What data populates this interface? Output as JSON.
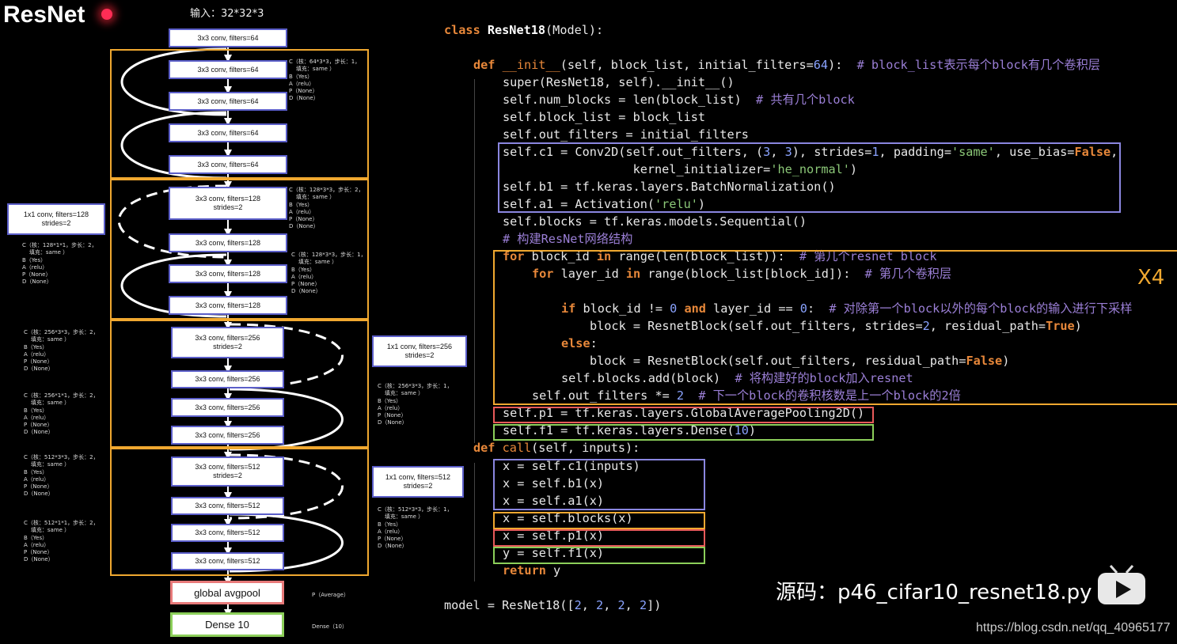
{
  "header": {
    "title": "ResNet",
    "input": "输入：32*32*3"
  },
  "diagram": {
    "stem": "3x3 conv, filters=64",
    "stage1": [
      "3x3 conv, filters=64",
      "3x3 conv, filters=64",
      "3x3 conv, filters=64",
      "3x3 conv, filters=64"
    ],
    "stage2": [
      "3x3 conv, filters=128\nstrides=2",
      "3x3 conv, filters=128",
      "3x3 conv, filters=128",
      "3x3 conv, filters=128"
    ],
    "stage3": [
      "3x3 conv, filters=256\nstrides=2",
      "3x3 conv, filters=256",
      "3x3 conv, filters=256",
      "3x3 conv, filters=256"
    ],
    "stage4": [
      "3x3 conv, filters=512\nstrides=2",
      "3x3 conv, filters=512",
      "3x3 conv, filters=512",
      "3x3 conv, filters=512"
    ],
    "shortcut128": "1x1 conv, filters=128\nstrides=2",
    "shortcut256": "1x1 conv, filters=256\nstrides=2",
    "shortcut512": "1x1 conv, filters=512\nstrides=2",
    "pool": "global avgpool",
    "dense": "Dense 10",
    "notes": {
      "s1": "C（核：64*3*3，步长：1，\n    填充：same ）\nB（Yes）\nA（relu）\nP（None）\nD（None）",
      "s2a": "C（核：128*3*3，步长：2，\n    填充：same ）\nB（Yes）\nA（relu）\nP（None）\nD（None）",
      "s2b": "C（核：128*3*3，步长：1，\n    填充：same ）\nB（Yes）\nA（relu）\nP（None）\nD（None）",
      "sc128": "C（核：128*1*1，步长：2，\n    填充：same ）\nB（Yes）\nA（relu）\nP（None）\nD（None）",
      "s3a": "C（核：256*3*3，步长：2，\n    填充：same ）\nB（Yes）\nA（relu）\nP（None）\nD（None）",
      "s3b": "C（核：256*1*1，步长：2，\n    填充：same ）\nB（Yes）\nA（relu）\nP（None）\nD（None）",
      "sc256": "C（核：256*3*3，步长：1，\n    填充：same ）\nB（Yes）\nA（relu）\nP（None）\nD（None）",
      "s4a": "C（核：512*3*3，步长：2，\n    填充：same ）\nB（Yes）\nA（relu）\nP（None）\nD（None）",
      "s4b": "C（核：512*1*1，步长：2，\n    填充：same ）\nB（Yes）\nA（relu）\nP（None）\nD（None）",
      "sc512": "C（核：512*3*3，步长：1，\n    填充：same ）\nB（Yes）\nA（relu）\nP（None）\nD（None）",
      "pool": "P（Average）",
      "dense": "Dense（10）"
    }
  },
  "code": {
    "lines": [
      [
        [
          "kw",
          "class "
        ],
        [
          "cls",
          "ResNet18"
        ],
        [
          "",
          "(Model):"
        ]
      ],
      [],
      [
        [
          "kw",
          "def "
        ],
        [
          "kw2",
          "__init__"
        ],
        [
          "",
          "(self, block_list, initial_filters="
        ],
        [
          "num",
          "64"
        ],
        [
          "",
          "):  "
        ],
        [
          "cmt",
          "# block_list表示每个block有几个卷积层"
        ]
      ],
      [
        [
          "",
          "super(ResNet18, self).__init__()"
        ]
      ],
      [
        [
          "",
          "self.num_blocks = len(block_list)  "
        ],
        [
          "cmt",
          "# 共有几个block"
        ]
      ],
      [
        [
          "",
          "self.block_list = block_list"
        ]
      ],
      [
        [
          "",
          "self.out_filters = initial_filters"
        ]
      ],
      [
        [
          "",
          "self.c1 = Conv2D(self.out_filters, ("
        ],
        [
          "num",
          "3"
        ],
        [
          "",
          ", "
        ],
        [
          "num",
          "3"
        ],
        [
          "",
          "), strides="
        ],
        [
          "num",
          "1"
        ],
        [
          "",
          ", padding="
        ],
        [
          "str",
          "'same'"
        ],
        [
          "",
          ", use_bias="
        ],
        [
          "kw",
          "False"
        ],
        [
          "",
          ","
        ]
      ],
      [
        [
          "",
          "                  kernel_initializer="
        ],
        [
          "str",
          "'he_normal'"
        ],
        [
          "",
          ")"
        ]
      ],
      [
        [
          "",
          "self.b1 = tf.keras.layers.BatchNormalization()"
        ]
      ],
      [
        [
          "",
          "self.a1 = Activation("
        ],
        [
          "str",
          "'relu'"
        ],
        [
          "",
          ")"
        ]
      ],
      [
        [
          "",
          "self.blocks = tf.keras.models.Sequential()"
        ]
      ],
      [
        [
          "cmt",
          "# 构建ResNet网络结构"
        ]
      ],
      [
        [
          "kw",
          "for "
        ],
        [
          "",
          "block_id "
        ],
        [
          "kw",
          "in "
        ],
        [
          "",
          "range(len(block_list)):  "
        ],
        [
          "cmt",
          "# 第几个resnet block"
        ]
      ],
      [
        [
          "kw",
          "for "
        ],
        [
          "",
          "layer_id "
        ],
        [
          "kw",
          "in "
        ],
        [
          "",
          "range(block_list[block_id]):  "
        ],
        [
          "cmt",
          "# 第几个卷积层"
        ]
      ],
      [],
      [
        [
          "kw",
          "if "
        ],
        [
          "",
          "block_id != "
        ],
        [
          "num",
          "0"
        ],
        [
          "",
          ""
        ],
        [
          "kw",
          " and "
        ],
        [
          "",
          "layer_id == "
        ],
        [
          "num",
          "0"
        ],
        [
          "",
          ":  "
        ],
        [
          "cmt",
          "# 对除第一个block以外的每个block的输入进行下采样"
        ]
      ],
      [
        [
          "",
          "block = ResnetBlock(self.out_filters, strides="
        ],
        [
          "num",
          "2"
        ],
        [
          "",
          ", residual_path="
        ],
        [
          "kw",
          "True"
        ],
        [
          "",
          ")"
        ]
      ],
      [
        [
          "kw",
          "else"
        ],
        [
          "",
          ":"
        ]
      ],
      [
        [
          "",
          "block = ResnetBlock(self.out_filters, residual_path="
        ],
        [
          "kw",
          "False"
        ],
        [
          "",
          ")"
        ]
      ],
      [
        [
          "",
          "self.blocks.add(block)  "
        ],
        [
          "cmt",
          "# 将构建好的block加入resnet"
        ]
      ],
      [
        [
          "",
          "self.out_filters *= "
        ],
        [
          "num",
          "2"
        ],
        [
          "",
          "  "
        ],
        [
          "cmt",
          "# 下一个block的卷积核数是上一个block的2倍"
        ]
      ],
      [
        [
          "",
          "self.p1 = tf.keras.layers.GlobalAveragePooling2D()"
        ]
      ],
      [
        [
          "",
          "self.f1 = tf.keras.layers.Dense("
        ],
        [
          "num",
          "10"
        ],
        [
          "",
          ")"
        ]
      ],
      [
        [
          "kw",
          "def "
        ],
        [
          "kw2",
          "call"
        ],
        [
          "",
          "(self, inputs):"
        ]
      ],
      [
        [
          "",
          "x = self.c1(inputs)"
        ]
      ],
      [
        [
          "",
          "x = self.b1(x)"
        ]
      ],
      [
        [
          "",
          "x = self.a1(x)"
        ]
      ],
      [
        [
          "",
          "x = self.blocks(x)"
        ]
      ],
      [
        [
          "",
          "x = self.p1(x)"
        ]
      ],
      [
        [
          "",
          "y = self.f1(x)"
        ]
      ],
      [
        [
          "kw",
          "return "
        ],
        [
          "",
          "y"
        ]
      ],
      [],
      [
        [
          "",
          "model = ResNet18(["
        ],
        [
          "num",
          "2"
        ],
        [
          "",
          ", "
        ],
        [
          "num",
          "2"
        ],
        [
          "",
          ", "
        ],
        [
          "num",
          "2"
        ],
        [
          "",
          ", "
        ],
        [
          "num",
          "2"
        ],
        [
          "",
          "])"
        ]
      ]
    ],
    "x4": "X4"
  },
  "footer": {
    "source": "源码：p46_cifar10_resnet18.py",
    "url": "https://blog.csdn.net/qq_40965177"
  },
  "colors": {
    "stage": "#f0a830",
    "blue": "#5b5ec9",
    "red": "#e85a5a",
    "green": "#8ccf5a",
    "keyword": "#e8883a",
    "comment": "#9b7fd6"
  }
}
